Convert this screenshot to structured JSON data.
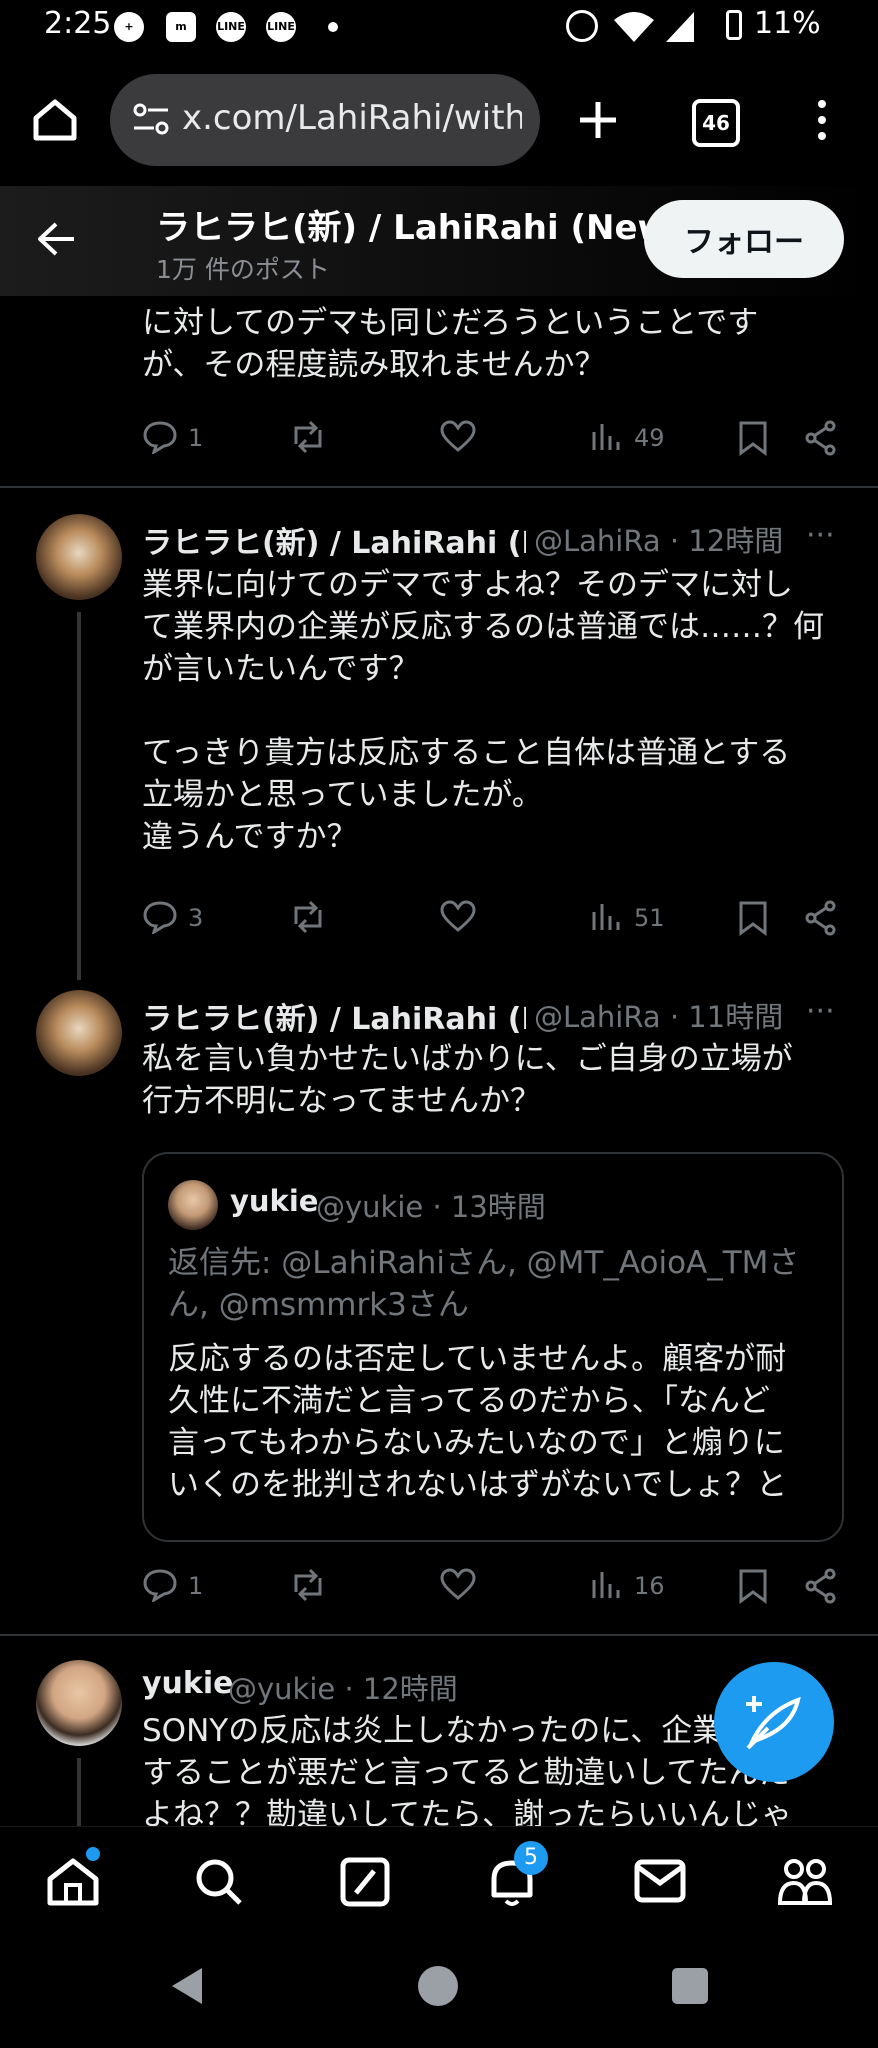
{
  "status_bar": {
    "time": "2:25",
    "icons": [
      "plus-badge-icon",
      "notification-icon",
      "line-icon",
      "line-icon"
    ],
    "line_label": "LINE",
    "battery": "11%"
  },
  "browser": {
    "url": "x.com/LahiRahi/with_",
    "tab_count": "46"
  },
  "profile_header": {
    "title": "ラヒラヒ(新) / LahiRahi (New)",
    "post_count": "1万 件のポスト",
    "follow_label": "フォロー"
  },
  "tweets": [
    {
      "text_lines": [
        "に対してのデマも同じだろうということです",
        "が、その程度読み取れませんか？"
      ],
      "replies": "1",
      "views": "49"
    },
    {
      "name": "ラヒラヒ(新) / LahiRahi (Ne",
      "handle_time": "@LahiRa · 12時間",
      "text_lines": [
        "業界に向けてのデマですよね？そのデマに対し",
        "て業界内の企業が反応するのは普通では……？何",
        "が言いたいんです？",
        "",
        "てっきり貴方は反応すること自体は普通とする",
        "立場かと思っていましたが。",
        "違うんですか？"
      ],
      "replies": "3",
      "views": "51"
    },
    {
      "name": "ラヒラヒ(新) / LahiRahi (Ne",
      "handle_time": "@LahiRa · 11時間",
      "text_lines": [
        "私を言い負かせたいばかりに、ご自身の立場が",
        "行方不明になってませんか？"
      ],
      "replies": "1",
      "views": "16",
      "quote": {
        "name": "yukie",
        "handle_time": "@yukie · 13時間",
        "reply_to_lines": [
          "返信先: @LahiRahiさん, @MT_AoioA_TMさ",
          "ん, @msmmrk3さん"
        ],
        "text_lines": [
          "反応するのは否定していませんよ。顧客が耐",
          "久性に不満だと言ってるのだから、「なんど",
          "言ってもわからないみたいなので」と煽りに",
          "いくのを批判されないはずがないでしょ？と"
        ]
      }
    },
    {
      "name": "yukie",
      "handle_time": "@yukie · 12時間",
      "text_lines": [
        "SONYの反応は炎上しなかったのに、企業",
        "することが悪だと言ってると勘違いしてたんだ",
        "よね？？勘違いしてたら、謝ったらいいんじゃ"
      ]
    }
  ],
  "bottom_nav": {
    "notification_badge": "5"
  },
  "colors": {
    "accent": "#1d9bf0",
    "muted": "#71767b",
    "background": "#000000"
  }
}
